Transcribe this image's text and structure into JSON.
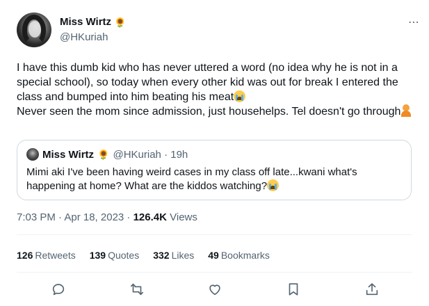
{
  "author": {
    "display_name": "Miss Wirtz",
    "name_emoji": "🌻",
    "handle": "@HKuriah"
  },
  "more_icon": "⋯",
  "tweet": {
    "lines": [
      "I have this dumb kid who has never uttered a word (no idea why he is not in a special school), so today when every other kid was out for break I entered the class and bumped into him beating his meat",
      "Never seen the mom since admission, just househelps. Tel doesn't go through"
    ],
    "emoji_1": "loudly-crying-face",
    "emoji_2": "person-shrugging"
  },
  "quote": {
    "display_name": "Miss Wirtz",
    "name_emoji": "🌻",
    "handle_time": "@HKuriah · 19h",
    "text": "Mimi aki I've been having weird cases in my class off late...kwani what's happening at home? What are the kiddos watching?",
    "emoji": "loudly-crying-face"
  },
  "meta": {
    "time_date": "7:03 PM · Apr 18, 2023 · ",
    "views_count": "126.4K",
    "views_label": " Views"
  },
  "stats": [
    {
      "count": "126",
      "label": "Retweets"
    },
    {
      "count": "139",
      "label": "Quotes"
    },
    {
      "count": "332",
      "label": "Likes"
    },
    {
      "count": "49",
      "label": "Bookmarks"
    }
  ],
  "actions": [
    "reply-icon",
    "retweet-icon",
    "like-icon",
    "bookmark-icon",
    "share-icon"
  ],
  "colors": {
    "text": "#0f1419",
    "secondary": "#536471",
    "border": "#cfd9de",
    "divider": "#eff3f4"
  }
}
